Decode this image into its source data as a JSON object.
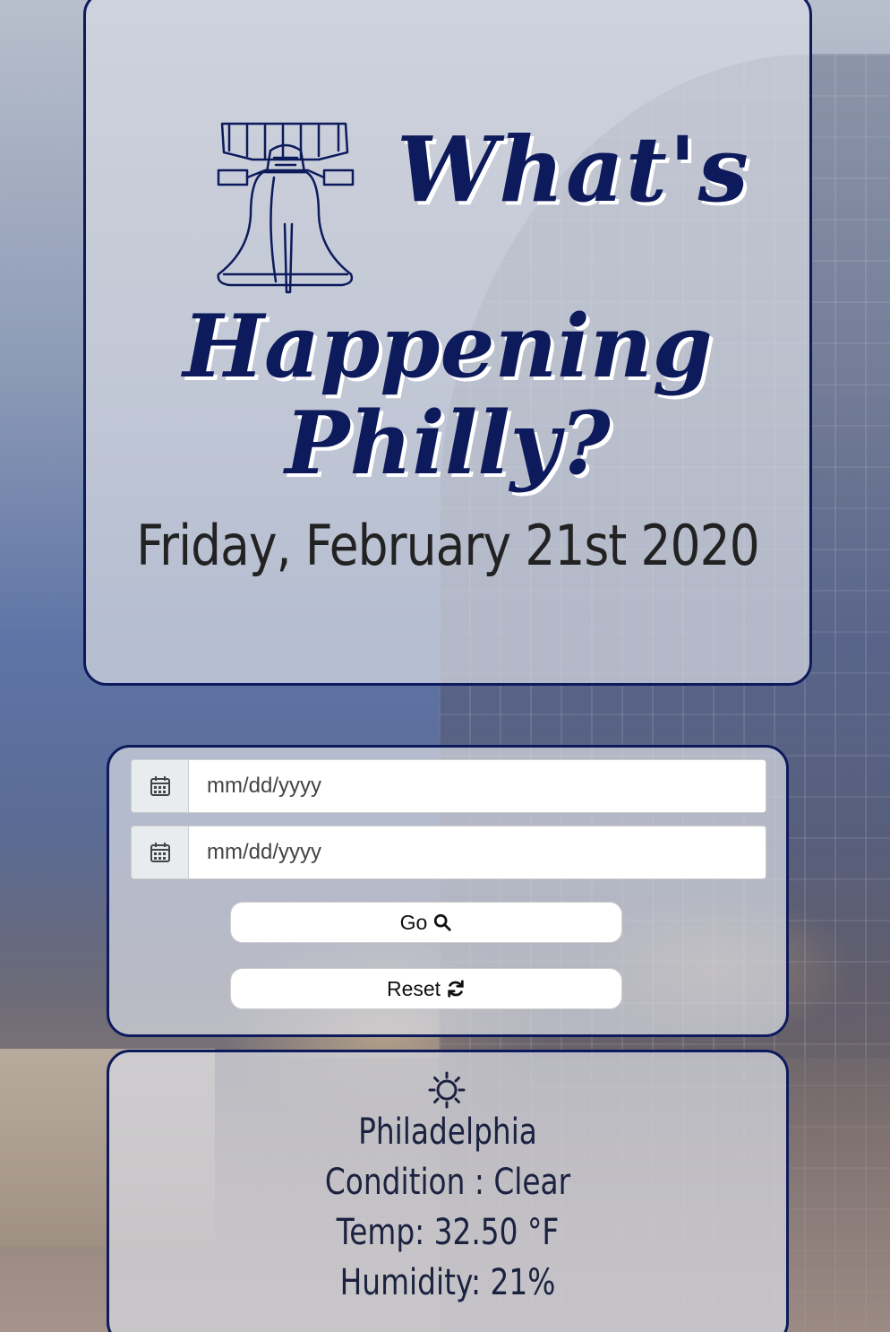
{
  "header": {
    "title_line1": "What's",
    "title_line2": "Happening",
    "title_line3": "Philly?",
    "date": "Friday, February 21st 2020",
    "logo_icon": "liberty-bell-icon"
  },
  "search": {
    "start_date": {
      "icon": "calendar-icon",
      "placeholder": "mm/dd/yyyy",
      "value": ""
    },
    "end_date": {
      "icon": "calendar-icon",
      "placeholder": "mm/dd/yyyy",
      "value": ""
    },
    "go_label": "Go",
    "go_icon": "search-icon",
    "reset_label": "Reset",
    "reset_icon": "refresh-icon"
  },
  "weather": {
    "icon": "sun-icon",
    "city": "Philadelphia",
    "condition": "Condition : Clear",
    "temp": "Temp: 32.50 °F",
    "humidity": "Humidity: 21%"
  },
  "colors": {
    "accent": "#0d1a5c",
    "panel_bg": "#d7dae2",
    "text": "#222222"
  }
}
